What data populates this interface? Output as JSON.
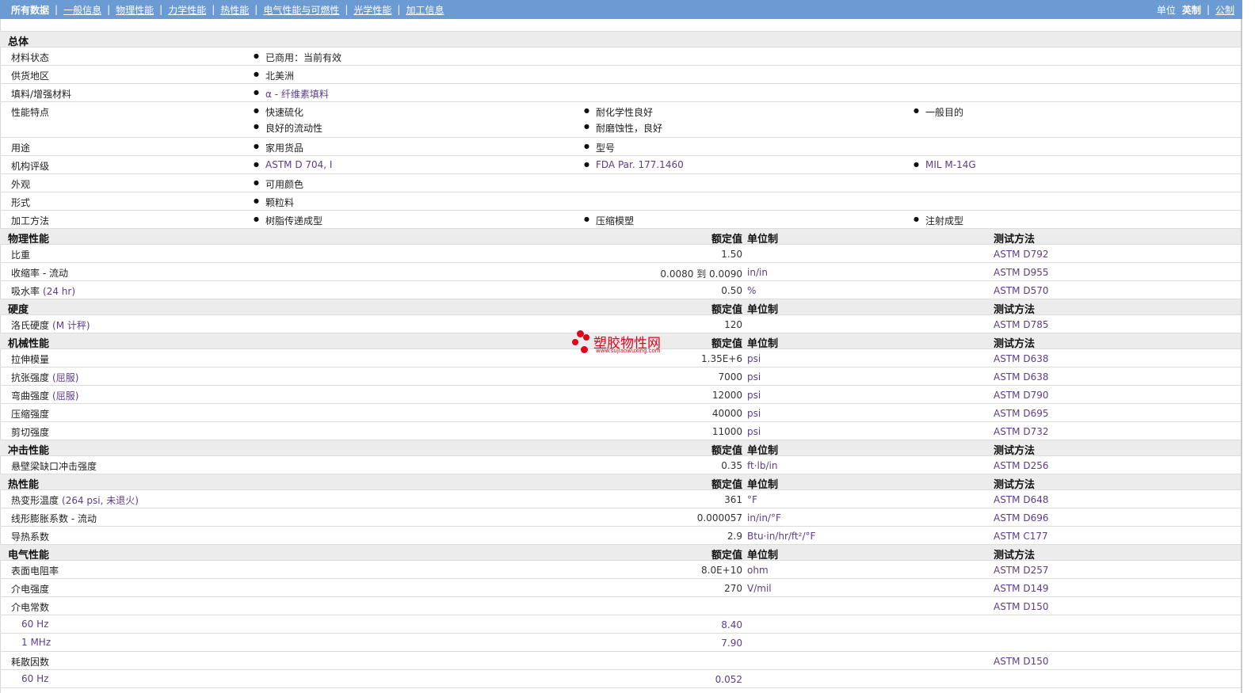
{
  "nav": {
    "items": [
      {
        "label": "所有数据",
        "active": true
      },
      {
        "label": "一般信息",
        "active": false
      },
      {
        "label": "物理性能",
        "active": false
      },
      {
        "label": "力学性能",
        "active": false
      },
      {
        "label": "热性能",
        "active": false
      },
      {
        "label": "电气性能与可燃性",
        "active": false
      },
      {
        "label": "光学性能",
        "active": false
      },
      {
        "label": "加工信息",
        "active": false
      }
    ],
    "unit_label": "单位",
    "unit_english": "英制",
    "unit_metric": "公制"
  },
  "general": {
    "title": "总体",
    "rows": [
      {
        "label": "材料状态",
        "items": [
          "已商用：当前有效"
        ]
      },
      {
        "label": "供货地区",
        "items": [
          "北美洲"
        ]
      },
      {
        "label": "填料/增强材料",
        "items": [
          "α - 纤维素填料"
        ],
        "link": true
      },
      {
        "label": "性能特点",
        "items": [
          "快速硫化",
          "耐化学性良好",
          "一般目的",
          "良好的流动性",
          "耐磨蚀性，良好"
        ]
      },
      {
        "label": "用途",
        "items": [
          "家用货品",
          "型号"
        ]
      },
      {
        "label": "机构评级",
        "items": [
          "ASTM D 704, I",
          "FDA Par. 177.1460",
          "MIL M-14G"
        ],
        "link": true
      },
      {
        "label": "外观",
        "items": [
          "可用颜色"
        ]
      },
      {
        "label": "形式",
        "items": [
          "颗粒料"
        ]
      },
      {
        "label": "加工方法",
        "items": [
          "树脂传递成型",
          "压缩模塑",
          "注射成型"
        ]
      }
    ]
  },
  "headers": {
    "nominal": "额定值",
    "unit": "单位制",
    "test": "测试方法"
  },
  "sections": [
    {
      "title": "物理性能",
      "rows": [
        {
          "label": "比重",
          "value": "1.50",
          "unit": "",
          "test": "ASTM D792"
        },
        {
          "label": "收缩率 - 流动",
          "value": "0.0080 到 0.0090",
          "unit": "in/in",
          "test": "ASTM D955"
        },
        {
          "label": "吸水率",
          "label_extra": "(24 hr)",
          "value": "0.50",
          "unit": "%",
          "test": "ASTM D570"
        }
      ]
    },
    {
      "title": "硬度",
      "rows": [
        {
          "label": "洛氏硬度",
          "label_extra": "(M 计秤)",
          "value": "120",
          "unit": "",
          "test": "ASTM D785"
        }
      ]
    },
    {
      "title": "机械性能",
      "rows": [
        {
          "label": "拉伸模量",
          "value": "1.35E+6",
          "unit": "psi",
          "test": "ASTM D638"
        },
        {
          "label": "抗张强度",
          "label_extra": "(屈服)",
          "value": "7000",
          "unit": "psi",
          "test": "ASTM D638"
        },
        {
          "label": "弯曲强度",
          "label_extra": "(屈服)",
          "value": "12000",
          "unit": "psi",
          "test": "ASTM D790"
        },
        {
          "label": "压缩强度",
          "value": "40000",
          "unit": "psi",
          "test": "ASTM D695"
        },
        {
          "label": "剪切强度",
          "value": "11000",
          "unit": "psi",
          "test": "ASTM D732"
        }
      ]
    },
    {
      "title": "冲击性能",
      "rows": [
        {
          "label": "悬壁梁缺口冲击强度",
          "value": "0.35",
          "unit": "ft·lb/in",
          "test": "ASTM D256"
        }
      ]
    },
    {
      "title": "热性能",
      "rows": [
        {
          "label": "热变形温度",
          "label_extra": "(264 psi, 未退火)",
          "value": "361",
          "unit": "°F",
          "test": "ASTM D648"
        },
        {
          "label": "线形膨胀系数 - 流动",
          "value": "0.000057",
          "unit": "in/in/°F",
          "test": "ASTM D696"
        },
        {
          "label": "导热系数",
          "value": "2.9",
          "unit": "Btu·in/hr/ft²/°F",
          "test": "ASTM C177"
        }
      ]
    },
    {
      "title": "电气性能",
      "rows": [
        {
          "label": "表面电阻率",
          "value": "8.0E+10",
          "unit": "ohm",
          "test": "ASTM D257"
        },
        {
          "label": "介电强度",
          "value": "270",
          "unit": "V/mil",
          "test": "ASTM D149"
        },
        {
          "label": "介电常数",
          "value": "",
          "unit": "",
          "test": "ASTM D150"
        },
        {
          "label": "60 Hz",
          "value": "8.40",
          "unit": "",
          "test": "",
          "sub": true
        },
        {
          "label": "1 MHz",
          "value": "7.90",
          "unit": "",
          "test": "",
          "sub": true
        },
        {
          "label": "耗散因数",
          "value": "",
          "unit": "",
          "test": "ASTM D150"
        },
        {
          "label": "60 Hz",
          "value": "0.052",
          "unit": "",
          "test": "",
          "sub": true
        }
      ]
    }
  ],
  "watermark": {
    "title": "塑胶物性网",
    "url": "www.sujiaowuxing.com"
  }
}
